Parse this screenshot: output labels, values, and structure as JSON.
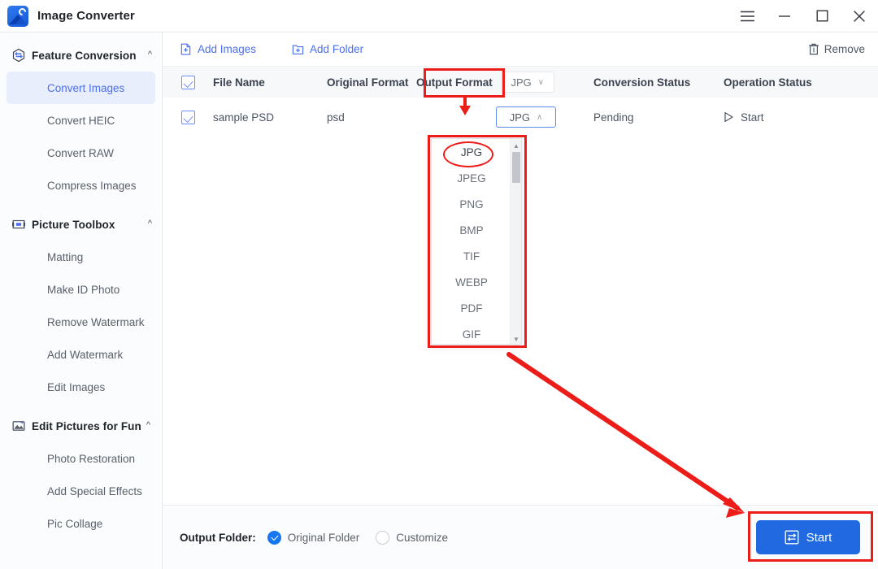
{
  "window": {
    "app_title": "Image Converter",
    "logo_icon": "image-converter-logo-icon",
    "controls": {
      "menu": "hamburger-menu-icon",
      "minimize": "minimize-icon",
      "maximize": "maximize-icon",
      "close": "close-icon"
    }
  },
  "sidebar": {
    "groups": [
      {
        "label": "Feature Conversion",
        "icon": "conversion-hex-icon",
        "expanded": true,
        "chevron": "^",
        "items": [
          {
            "label": "Convert Images",
            "active": true
          },
          {
            "label": "Convert HEIC",
            "active": false
          },
          {
            "label": "Convert RAW",
            "active": false
          },
          {
            "label": "Compress Images",
            "active": false
          }
        ]
      },
      {
        "label": "Picture Toolbox",
        "icon": "toolbox-icon",
        "expanded": true,
        "chevron": "^",
        "items": [
          {
            "label": "Matting",
            "active": false
          },
          {
            "label": "Make ID Photo",
            "active": false
          },
          {
            "label": "Remove Watermark",
            "active": false
          },
          {
            "label": "Add Watermark",
            "active": false
          },
          {
            "label": "Edit Images",
            "active": false
          }
        ]
      },
      {
        "label": "Edit Pictures for Fun",
        "icon": "magic-photo-icon",
        "expanded": true,
        "chevron": "^",
        "items": [
          {
            "label": "Photo Restoration",
            "active": false
          },
          {
            "label": "Add Special Effects",
            "active": false
          },
          {
            "label": "Pic Collage",
            "active": false
          }
        ]
      }
    ]
  },
  "toolbar": {
    "add_images_label": "Add Images",
    "add_images_icon": "add-file-icon",
    "add_folder_label": "Add Folder",
    "add_folder_icon": "add-folder-icon",
    "remove_label": "Remove",
    "remove_icon": "trash-icon"
  },
  "table": {
    "headers": {
      "file_name": "File Name",
      "original_format": "Original Format",
      "output_format": "Output Format",
      "conversion_status": "Conversion Status",
      "operation_status": "Operation Status"
    },
    "header_select": {
      "value": "JPG",
      "chevron": "∨"
    },
    "rows": [
      {
        "checked": true,
        "file_name": "sample PSD",
        "original_format": "psd",
        "output_format": "JPG",
        "output_chevron": "∧",
        "conversion_status": "Pending",
        "operation_status": "Start",
        "operation_icon": "play-triangle-icon"
      }
    ]
  },
  "dropdown": {
    "open": true,
    "selected": "JPG",
    "options": [
      "JPG",
      "JPEG",
      "PNG",
      "BMP",
      "TIF",
      "WEBP",
      "PDF",
      "GIF"
    ],
    "scrollbar": {
      "up_arrow": "▲",
      "down_arrow": "▼"
    }
  },
  "bottom": {
    "output_folder_label": "Output Folder:",
    "options": [
      {
        "label": "Original Folder",
        "selected": true
      },
      {
        "label": "Customize",
        "selected": false
      }
    ],
    "start_button": {
      "label": "Start",
      "icon": "convert-arrows-icon"
    }
  },
  "annotations": {
    "color": "#ec1c18",
    "highlight_output_format_header": "Output Format",
    "highlight_selected_option": "JPG",
    "arrow_down_to_select": "arrow-down-icon",
    "arrow_diagonal_to_start": "arrow-diagonal-icon"
  },
  "colors": {
    "accent": "#4b6ef0",
    "primary_button": "#2069e0",
    "annotation": "#ec1c18",
    "active_item_bg": "#e8eefc",
    "sidebar_bg": "#fbfcfd"
  }
}
